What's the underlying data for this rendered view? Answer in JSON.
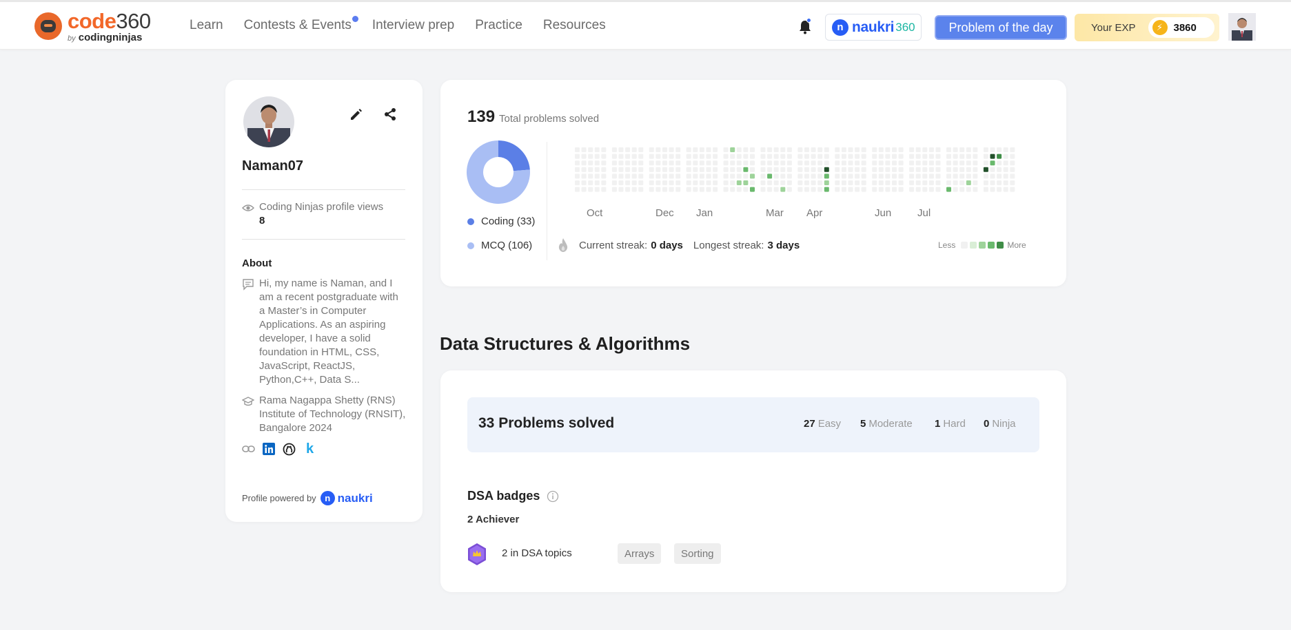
{
  "app": {
    "logo_main_a": "code",
    "logo_main_b": "360",
    "logo_sub_by": "by",
    "logo_sub_brand": "codingninjas"
  },
  "nav": {
    "items": [
      {
        "label": "Learn"
      },
      {
        "label": "Contests & Events",
        "has_dot": true
      },
      {
        "label": "Interview prep"
      },
      {
        "label": "Practice"
      },
      {
        "label": "Resources"
      }
    ]
  },
  "header": {
    "naukri_logo_letter": "n",
    "naukri_word": "naukri",
    "naukri_suffix": "360",
    "potd_label": "Problem of the day",
    "exp_label": "Your EXP",
    "exp_value": "3860"
  },
  "profile": {
    "username": "Naman07",
    "views_label": "Coding Ninjas profile views",
    "views_count": "8",
    "about_title": "About",
    "about_text": "Hi, my name is Naman, and I am a recent postgraduate with a Master’s in Computer Applications. As an aspiring developer, I have a solid foundation in HTML, CSS, JavaScript, ReactJS, Python,C++, Data S...",
    "college": "Rama Nagappa Shetty (RNS) Institute of Technology (RNSIT), Bangalore 2024",
    "k_link": "k",
    "powered_by": "Profile powered by",
    "powered_word": "naukri"
  },
  "stats": {
    "total_solved": "139",
    "total_label": "Total problems solved",
    "coding_label": "Coding (33)",
    "mcq_label": "MCQ (106)",
    "coding_count": 33,
    "mcq_count": 106,
    "months": [
      "Oct",
      "Dec",
      "Jan",
      "Mar",
      "Apr",
      "Jun",
      "Jul"
    ],
    "current_streak_label": "Current streak:",
    "current_streak_value": "0 days",
    "longest_streak_label": "Longest streak:",
    "longest_streak_value": "3 days",
    "legend_less": "Less",
    "legend_more": "More",
    "colors": {
      "coding": "#5b7fe6",
      "mcq": "#a9bef4",
      "heat_empty": "#f1f1f1",
      "heat_1": "#9ed39a",
      "heat_2": "#6ab96d",
      "heat_3": "#3f8d47",
      "heat_4": "#22502a"
    }
  },
  "dsa": {
    "section_title": "Data Structures & Algorithms",
    "solved_title": "33 Problems solved",
    "easy_count": "27",
    "easy_label": "Easy",
    "moderate_count": "5",
    "moderate_label": "Moderate",
    "hard_count": "1",
    "hard_label": "Hard",
    "ninja_count": "0",
    "ninja_label": "Ninja",
    "badges_title": "DSA badges",
    "achiever": "2 Achiever",
    "badge_label": "2 in DSA topics",
    "topics": [
      "Arrays",
      "Sorting"
    ]
  }
}
